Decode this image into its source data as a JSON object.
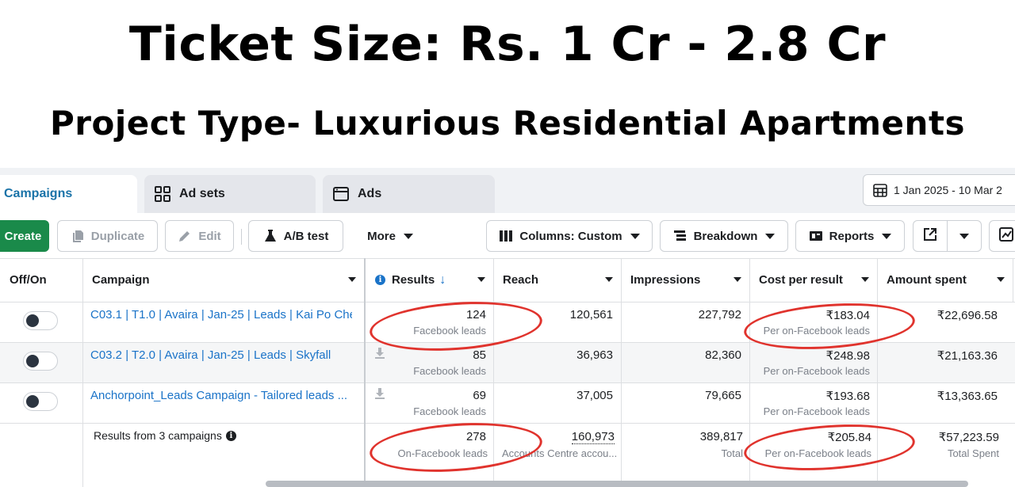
{
  "headline": {
    "title": "Ticket Size: Rs. 1 Cr - 2.8 Cr",
    "subtitle": "Project Type- Luxurious Residential Apartments"
  },
  "tabs": [
    {
      "label": "Campaigns",
      "active": true
    },
    {
      "label": "Ad sets",
      "icon": "ad-sets-grid-icon"
    },
    {
      "label": "Ads",
      "icon": "ads-window-icon"
    }
  ],
  "date_range": "1 Jan 2025 - 10 Mar 2",
  "toolbar": {
    "create": "Create",
    "duplicate": "Duplicate",
    "edit": "Edit",
    "ab_test": "A/B test",
    "more": "More",
    "columns": "Columns: Custom",
    "breakdown": "Breakdown",
    "reports": "Reports"
  },
  "columns": {
    "off_on": "Off/On",
    "campaign": "Campaign",
    "results": "Results",
    "reach": "Reach",
    "impressions": "Impressions",
    "cost_per_result": "Cost per result",
    "amount_spent": "Amount spent"
  },
  "rows": [
    {
      "campaign": "C03.1 | T1.0 | Avaira | Jan-25 | Leads | Kai Po Che",
      "results": "124",
      "results_type": "Facebook leads",
      "reach": "120,561",
      "impressions": "227,792",
      "cost": "₹183.04",
      "cost_type": "Per on-Facebook leads",
      "spent": "₹22,696.58",
      "on": true
    },
    {
      "campaign": "C03.2 | T2.0 | Avaira | Jan-25 | Leads | Skyfall",
      "results": "85",
      "results_type": "Facebook leads",
      "reach": "36,963",
      "impressions": "82,360",
      "cost": "₹248.98",
      "cost_type": "Per on-Facebook leads",
      "spent": "₹21,163.36",
      "on": true
    },
    {
      "campaign": "Anchorpoint_Leads Campaign - Tailored leads ...",
      "results": "69",
      "results_type": "Facebook leads",
      "reach": "37,005",
      "impressions": "79,665",
      "cost": "₹193.68",
      "cost_type": "Per on-Facebook leads",
      "spent": "₹13,363.65",
      "on": true
    }
  ],
  "summary": {
    "label": "Results from 3 campaigns",
    "results": "278",
    "results_type": "On-Facebook leads",
    "reach": "160,973",
    "reach_type": "Accounts Centre accou...",
    "impressions": "389,817",
    "impressions_type": "Total",
    "cost": "₹205.84",
    "cost_type": "Per on-Facebook leads",
    "spent": "₹57,223.59",
    "spent_type": "Total Spent"
  },
  "colors": {
    "accent": "#1a73c8",
    "create_button": "#1a8a4a",
    "annotation": "#e0332d"
  }
}
